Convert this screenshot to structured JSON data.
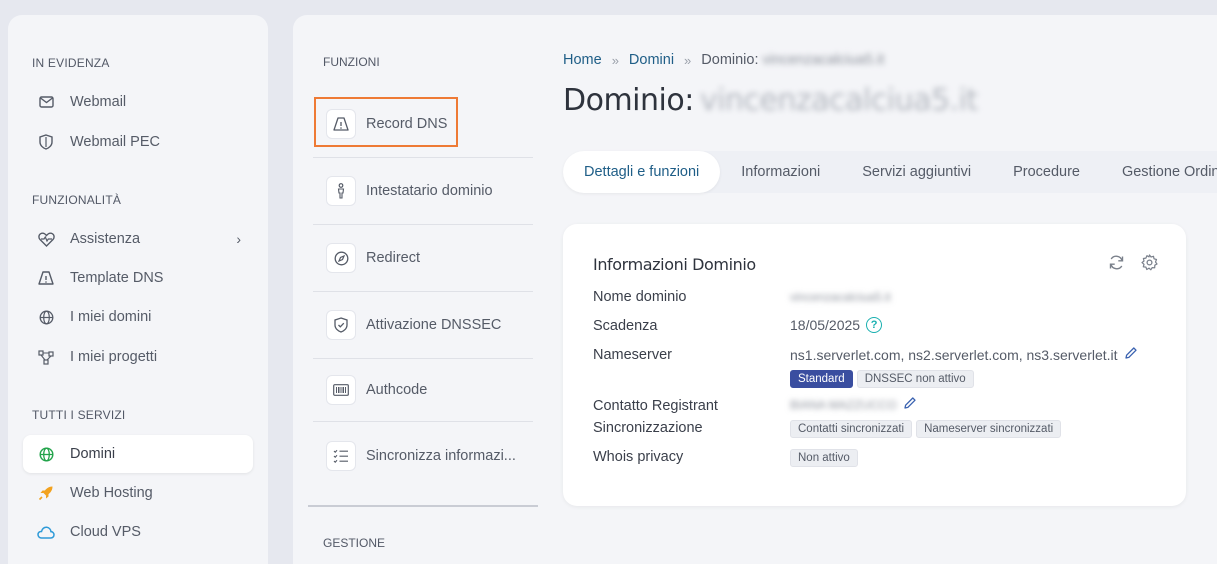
{
  "sidebar": {
    "sections": [
      {
        "title": "IN EVIDENZA"
      },
      {
        "title": "FUNZIONALITÀ"
      },
      {
        "title": "TUTTI I SERVIZI"
      }
    ],
    "items": [
      {
        "label": "Webmail",
        "icon": "envelope-icon"
      },
      {
        "label": "Webmail PEC",
        "icon": "shield-icon"
      },
      {
        "label": "Assistenza",
        "icon": "heart-pulse-icon"
      },
      {
        "label": "Template DNS",
        "icon": "warning-triangle-icon"
      },
      {
        "label": "I miei domini",
        "icon": "globe-icon"
      },
      {
        "label": "I miei progetti",
        "icon": "network-icon"
      },
      {
        "label": "Domini",
        "icon": "globe-icon"
      },
      {
        "label": "Web Hosting",
        "icon": "rocket-icon"
      },
      {
        "label": "Cloud VPS",
        "icon": "cloud-icon"
      }
    ]
  },
  "functions": {
    "title": "FUNZIONI",
    "items": [
      {
        "label": "Record DNS",
        "icon": "warning-triangle-icon"
      },
      {
        "label": "Intestatario dominio",
        "icon": "person-icon"
      },
      {
        "label": "Redirect",
        "icon": "compass-icon"
      },
      {
        "label": "Attivazione DNSSEC",
        "icon": "shield-check-icon"
      },
      {
        "label": "Authcode",
        "icon": "barcode-icon"
      },
      {
        "label": "Sincronizza informazi...",
        "icon": "checklist-icon"
      }
    ],
    "gestione_title": "GESTIONE"
  },
  "breadcrumb": {
    "home": "Home",
    "domini": "Domini",
    "current_prefix": "Dominio:",
    "current_blurred": "vincenzacalciua5.it"
  },
  "page_title": {
    "prefix": "Dominio:",
    "blurred": "vincenzacalciua5.it"
  },
  "tabs": [
    "Dettagli e funzioni",
    "Informazioni",
    "Servizi aggiuntivi",
    "Procedure",
    "Gestione Ordini"
  ],
  "card": {
    "title": "Informazioni Dominio",
    "rows": {
      "nome_label": "Nome dominio",
      "nome_value": "vincenzacalciua5.it",
      "scadenza_label": "Scadenza",
      "scadenza_value": "18/05/2025",
      "nameserver_label": "Nameserver",
      "nameserver_value": "ns1.serverlet.com, ns2.serverlet.com, ns3.serverlet.it",
      "ns_badge_standard": "Standard",
      "ns_badge_dnssec": "DNSSEC non attivo",
      "contatto_label": "Contatto Registrant",
      "contatto_value": "BIANA MAZZUCCO",
      "sincro_label": "Sincronizzazione",
      "sincro_badge1": "Contatti sincronizzati",
      "sincro_badge2": "Nameserver sincronizzati",
      "whois_label": "Whois privacy",
      "whois_badge": "Non attivo"
    }
  },
  "colors": {
    "accent_link": "#1f5e87",
    "highlight_border": "#ee7a35",
    "badge_blue": "#3a4ea0",
    "help_teal": "#1ab0b0"
  }
}
